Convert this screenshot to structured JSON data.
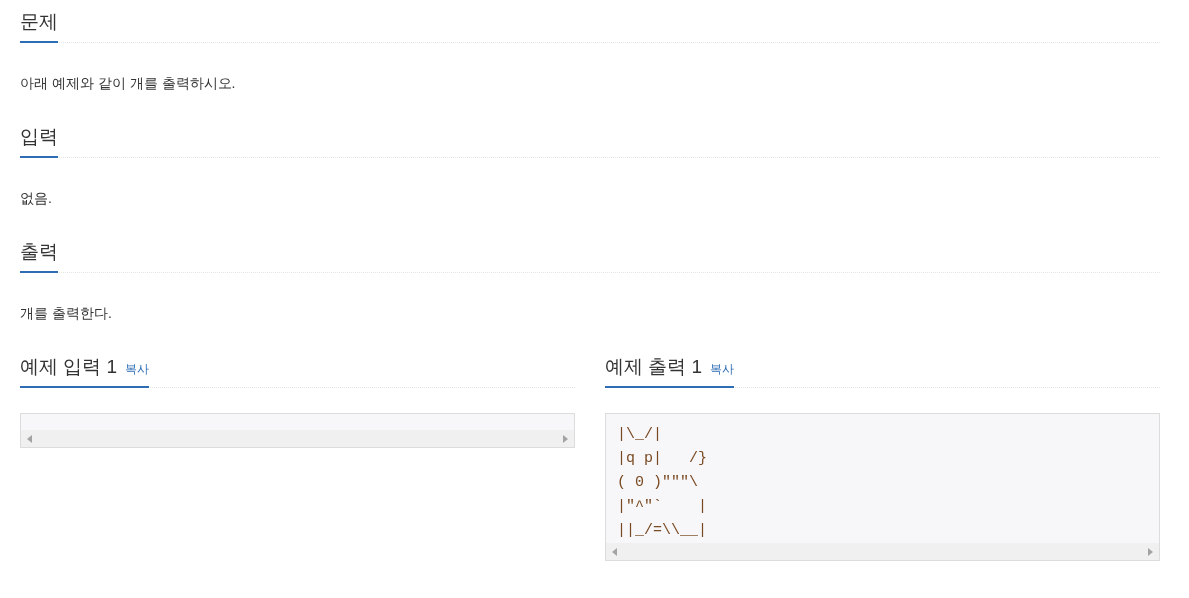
{
  "sections": [
    {
      "heading": "문제",
      "body": "아래 예제와 같이 개를 출력하시오."
    },
    {
      "heading": "입력",
      "body": "없음."
    },
    {
      "heading": "출력",
      "body": "개를 출력한다."
    }
  ],
  "samples": [
    {
      "heading": "예제 입력 1",
      "copy": "복사"
    },
    {
      "heading": "예제 출력 1",
      "copy": "복사",
      "lines": [
        "|\\_/|",
        "|q p|   /}",
        "( 0 )\"\"\"\\",
        "|\"^\"`    |",
        "||_/=\\\\__|"
      ]
    }
  ]
}
